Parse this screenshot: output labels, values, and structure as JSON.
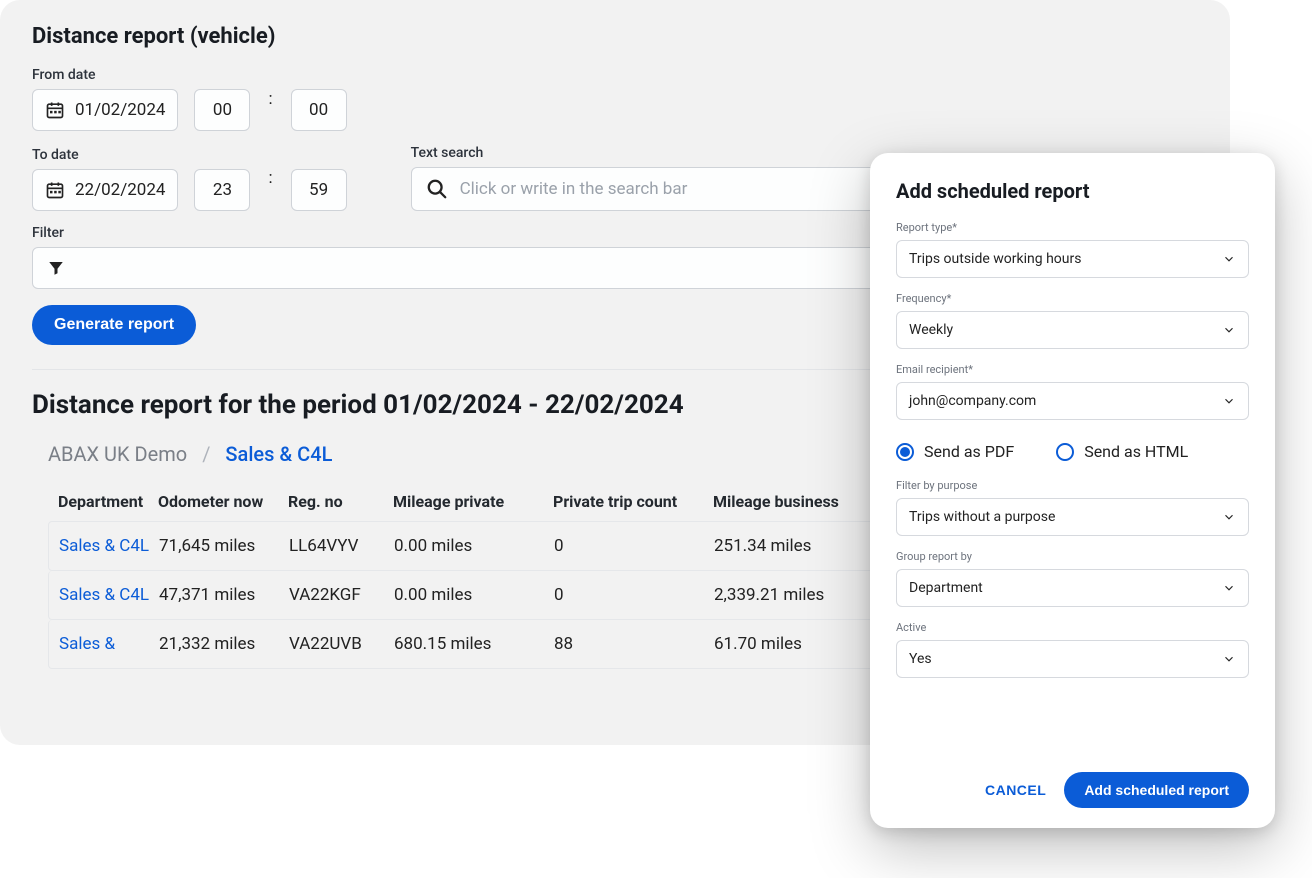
{
  "main": {
    "title": "Distance report (vehicle)",
    "from_label": "From date",
    "from_date": "01/02/2024",
    "from_hour": "00",
    "from_min": "00",
    "to_label": "To date",
    "to_date": "22/02/2024",
    "to_hour": "23",
    "to_min": "59",
    "search_label": "Text search",
    "search_placeholder": "Click or write in the search bar",
    "filter_label": "Filter",
    "generate_btn": "Generate report",
    "period_title": "Distance report for the period 01/02/2024 - 22/02/2024",
    "breadcrumb_root": "ABAX UK Demo",
    "breadcrumb_current": "Sales & C4L",
    "columns": {
      "dept": "Department",
      "odo": "Odometer now",
      "reg": "Reg. no",
      "mpriv": "Mileage private",
      "pcnt": "Private trip count",
      "mbus": "Mileage business"
    },
    "rows": [
      {
        "dept": "Sales & C4L",
        "odo": "71,645 miles",
        "reg": "LL64VYV",
        "mpriv": "0.00 miles",
        "pcnt": "0",
        "mbus": "251.34 miles"
      },
      {
        "dept": "Sales & C4L",
        "odo": "47,371 miles",
        "reg": "VA22KGF",
        "mpriv": "0.00 miles",
        "pcnt": "0",
        "mbus": "2,339.21 miles"
      },
      {
        "dept": "Sales &",
        "odo": "21,332 miles",
        "reg": "VA22UVB",
        "mpriv": "680.15 miles",
        "pcnt": "88",
        "mbus": "61.70 miles"
      }
    ]
  },
  "modal": {
    "title": "Add scheduled report",
    "report_type_label": "Report type*",
    "report_type_value": "Trips outside working hours",
    "frequency_label": "Frequency*",
    "frequency_value": "Weekly",
    "recipient_label": "Email recipient*",
    "recipient_value": "john@company.com",
    "radio_pdf": "Send as PDF",
    "radio_html": "Send as HTML",
    "filter_purpose_label": "Filter by purpose",
    "filter_purpose_value": "Trips without a purpose",
    "group_by_label": "Group report by",
    "group_by_value": "Department",
    "active_label": "Active",
    "active_value": "Yes",
    "cancel": "CANCEL",
    "submit": "Add scheduled report"
  }
}
